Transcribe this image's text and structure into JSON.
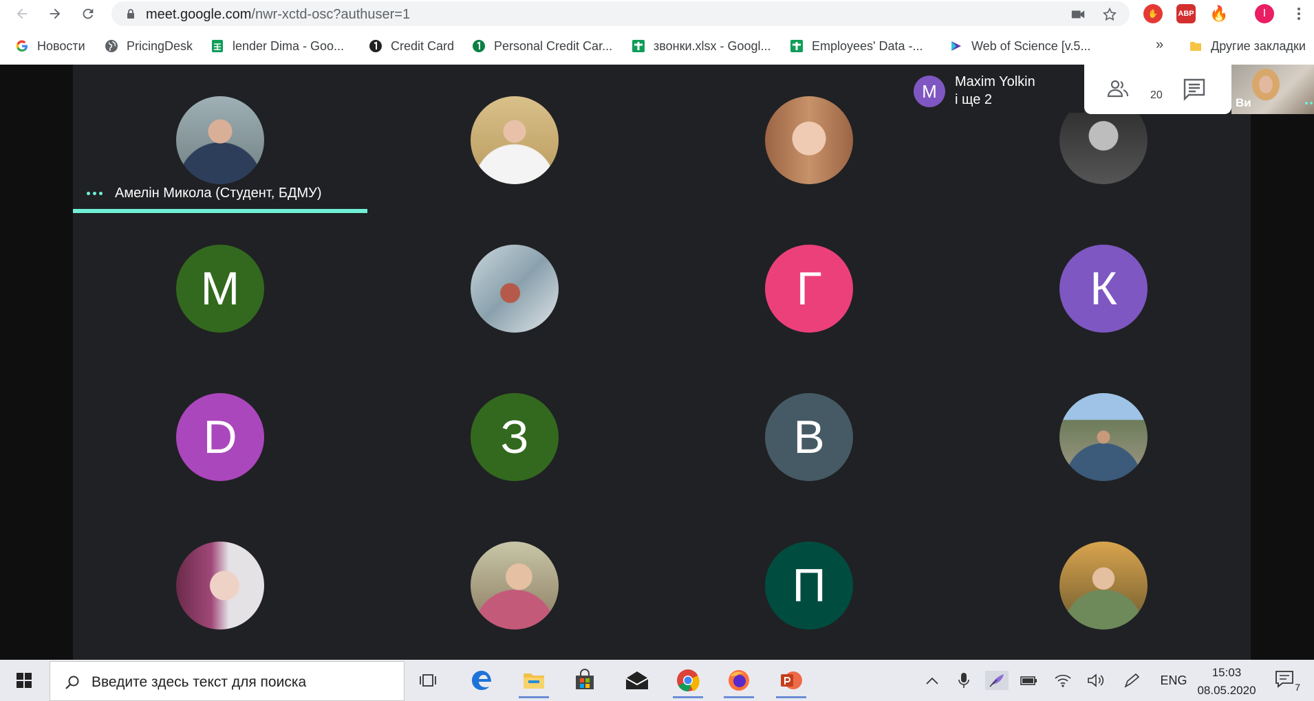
{
  "browser": {
    "url_host": "meet.google.com",
    "url_path": "/nwr-xctd-osc?authuser=1",
    "profile_initial": "I",
    "ext_abp_label": "ABP",
    "bookmarks": [
      {
        "label": "Новости",
        "icon": "google-icon"
      },
      {
        "label": "PricingDesk",
        "icon": "globe-icon"
      },
      {
        "label": "lender Dima - Goo...",
        "icon": "sheets-icon"
      },
      {
        "label": "Credit Card",
        "icon": "one-icon"
      },
      {
        "label": "Personal Credit Car...",
        "icon": "circle-one-icon"
      },
      {
        "label": "звонки.xlsx - Googl...",
        "icon": "sheets-plus-icon"
      },
      {
        "label": "Employees' Data -...",
        "icon": "sheets-plus-icon"
      },
      {
        "label": "Web of Science [v.5...",
        "icon": "clarivate-icon"
      }
    ],
    "more_bookmarks": "»",
    "other_bookmarks": "Другие закладки"
  },
  "meet": {
    "active_speaker": "Амелін Микола (Студент, БДМУ)",
    "presenter": {
      "initial": "M",
      "name": "Maxim Yolkin",
      "more": "і ще 2"
    },
    "participants_count": "20",
    "self_label": "Ви",
    "tiles": [
      {
        "type": "photo",
        "initial": ""
      },
      {
        "type": "photo",
        "initial": ""
      },
      {
        "type": "photo",
        "initial": ""
      },
      {
        "type": "photo",
        "initial": ""
      },
      {
        "type": "initial",
        "initial": "M",
        "color": "#33691e"
      },
      {
        "type": "photo",
        "initial": ""
      },
      {
        "type": "initial",
        "initial": "Г",
        "color": "#ec407a"
      },
      {
        "type": "initial",
        "initial": "К",
        "color": "#7e57c2"
      },
      {
        "type": "initial",
        "initial": "D",
        "color": "#ab47bc"
      },
      {
        "type": "initial",
        "initial": "З",
        "color": "#33691e"
      },
      {
        "type": "initial",
        "initial": "В",
        "color": "#455a64"
      },
      {
        "type": "photo",
        "initial": ""
      },
      {
        "type": "photo",
        "initial": ""
      },
      {
        "type": "photo",
        "initial": ""
      },
      {
        "type": "initial",
        "initial": "П",
        "color": "#004d40"
      },
      {
        "type": "photo",
        "initial": ""
      }
    ]
  },
  "taskbar": {
    "search_placeholder": "Введите здесь текст для поиска",
    "language": "ENG",
    "time": "15:03",
    "date": "08.05.2020",
    "notifications": "7"
  }
}
